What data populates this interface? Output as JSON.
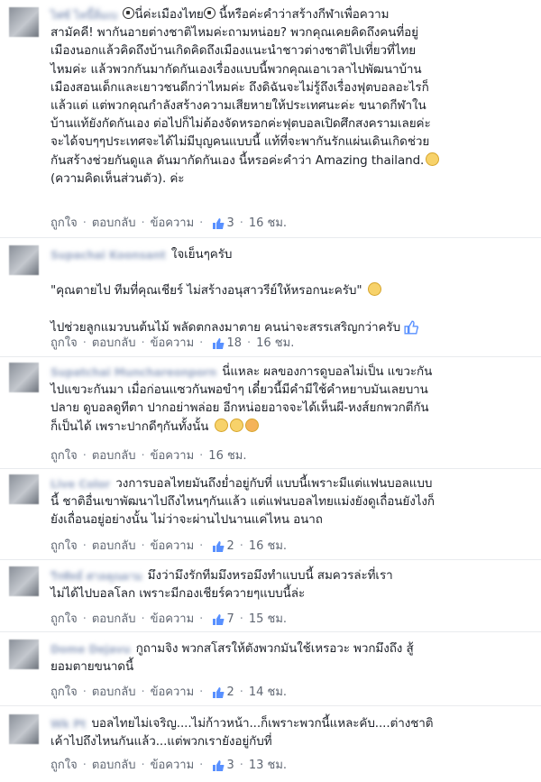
{
  "actions": {
    "like": "ถูกใจ",
    "reply": "ตอบกลับ",
    "message": "ข้อความ"
  },
  "comments": [
    {
      "name": "ไพ่ซ์ ไหนี้ลิ่มเบ",
      "text_a": "",
      "text_b": "นี่ค่ะเมืองไทย",
      "text_c": " นี้หรือค่ะคำว่าสร้างกีฬาเพื่อความ\nสามัคคี! พากันอายต่างชาติไหมค่ะถามหน่อย? พวกคุณเคยคิดถึงคนที่อยู่\nเมืองนอกแล้วคิดถึงบ้านเกิดคิดถึงเมืองแนะนำชาวต่างชาติไปเที่ยวที่ไทย\nไหมค่ะ แล้วพวกกันมากัดกันเองเรื่องแบบนี้พวกคุณเอาเวลาไปพัฒนาบ้าน\nเมืองสอนเด็กและเยาวชนดีกว่าไหมค่ะ ถึงดิฉันจะไม่รู้ถึงเรื่องฟุตบอลอะไรก็\nแล้วแต่ แต่พวกคุณกำลังสร้างความเสียหายให้ประเทศนะค่ะ ขนาดกีฬาใน\nบ้านแท้ยังกัดกันเอง ต่อไปก็ไม่ต้องจัดหรอกค่ะฟุตบอลเปิดศึกสงครามเลยค่ะ\nจะได้จบๆๆประเทศจะได้ไม่มีบุญคนแบบนี้ แท้ที่จะพากันรักแผ่นเดินเกิดช่วย\nกันสร้างช่วยกันดูแล ดันมากัดกันเอง นี้หรอค่ะคำว่า Amazing thailand.",
      "text_d": "\n(ความคิดเห็นส่วนตัว). ค่ะ",
      "likes": "3",
      "time": "16 ชม."
    },
    {
      "name": "Supachai Koonsant",
      "text": "ใจเย็นๆครับ\n\n\"คุณตายไป ทีมที่คุณเชียร์ ไม่สร้างอนุสาวรีย์ให้หรอกนะครับ\"",
      "text2": "\n\nไปช่วยลูกแมวบนต้นไม้ พลัดตกลงมาตาย คนน่าจะสรรเสริญกว่าครับ",
      "likes": "18",
      "time": "16 ชม."
    },
    {
      "name": "Supatchai Munchareonporn",
      "text": "นี่แหละ ผลของการดูบอลไม่เป็น แขวะกัน\nไปแขวะกันมา เมื่อก่อนแซวกันพอขำๆ เดี๋ยวนี้มีคำมีใช้คำหยาบมันเลยบาน\nปลาย ดูบอลดูทีตา ปากอย่าพล่อย อีกหน่อยอาจจะได้เห็นผี-หงส์ยกพวกตีกัน\nก็เป็นได้ เพราะปากดีๆกันทั้งนั้น",
      "likes": "",
      "time": "16 ชม."
    },
    {
      "name": "Live Color",
      "text": "วงการบอลไทยมันถึงย่ำอยู่กับที่ แบบนี้เพราะมีแต่แฟนบอลแบบ\nนี้ ชาติอื่นเขาพัฒนาไปถึงไหนๆกันแล้ว แต่แฟนบอลไทยแม่งยังดูเถื่อนยังไงก็\nยังเถื่อนอยู่อย่างนั้น ไม่ว่าจะผ่านไปนานแค่ไหน อนาถ",
      "likes": "2",
      "time": "16 ชม."
    },
    {
      "name": "วีรพัทธ์ ศาลคุณผาม",
      "text": "มึงว่ามึงรักทีมมึงหรอมึงทำแบบนี้ สมควรล่ะที่เรา\nไม่ได้ไปบอลโลก เพราะมีกองเชียร์ควายๆแบบนี้ล่ะ",
      "likes": "7",
      "time": "15 ชม."
    },
    {
      "name": "Dome Dejavu",
      "text": "กูถามจิง พวกสโสรให้ตังพวกมันใช้เหรอวะ พวกมึงถึง สู้\nยอมตายขนาดนี้",
      "likes": "2",
      "time": "14 ชม."
    },
    {
      "name": "Wk Pt",
      "text": "บอลไทยไม่เจริญ....ไม่ก้าวหน้า...ก็เพราะพวกนี้แหละคับ....ต่างชาติ\nเค้าไปถึงไหนกันแล้ว...แต่พวกเรายังอยู่กับที่",
      "likes": "3",
      "time": "13 ชม."
    }
  ],
  "colors": {
    "like_blue": "#5890ff",
    "link_gray": "#5f6672"
  }
}
